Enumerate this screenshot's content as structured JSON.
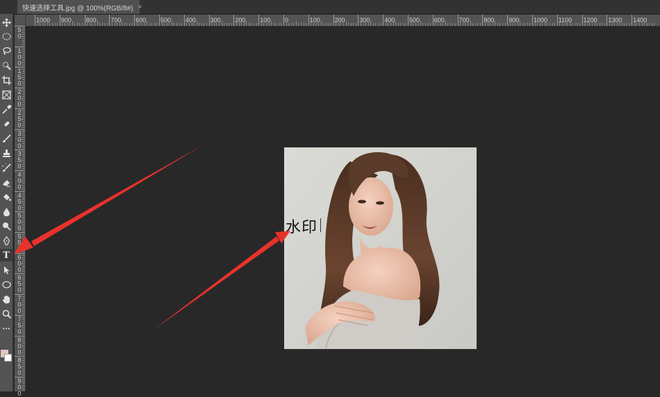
{
  "document_tab": {
    "title": "快速选择工具.jpg @ 100%(RGB/8#)",
    "close_glyph": "×"
  },
  "ruler": {
    "horizontal_labels": [
      "1000",
      "900",
      "800",
      "700",
      "600",
      "500",
      "400",
      "300",
      "200",
      "100",
      "0",
      "100",
      "200",
      "300",
      "400",
      "500",
      "600",
      "700",
      "800",
      "900",
      "1000",
      "1100",
      "1200",
      "1300",
      "1400"
    ],
    "vertical_labels": [
      "5\n0",
      "1\n0\n0",
      "1\n5\n0",
      "2\n0\n0",
      "2\n5\n0",
      "3\n0\n0",
      "3\n5\n0",
      "4\n0\n0",
      "4\n5\n0",
      "5\n0\n0",
      "5\n5\n0",
      "6\n0\n0",
      "6\n5\n0",
      "7\n0\n0",
      "7\n5\n0",
      "8\n0\n0",
      "8\n5\n0",
      "9\n0\n0"
    ]
  },
  "toolbar": {
    "tools": [
      {
        "name": "move-tool",
        "icon": "move-icon"
      },
      {
        "name": "marquee-tool",
        "icon": "ellipse-marquee-icon"
      },
      {
        "name": "lasso-tool",
        "icon": "lasso-icon"
      },
      {
        "name": "quick-selection-tool",
        "icon": "quick-selection-icon"
      },
      {
        "name": "crop-tool",
        "icon": "crop-icon"
      },
      {
        "name": "frame-tool",
        "icon": "frame-icon"
      },
      {
        "name": "eyedropper-tool",
        "icon": "eyedropper-icon"
      },
      {
        "name": "healing-brush-tool",
        "icon": "bandage-icon"
      },
      {
        "name": "brush-tool",
        "icon": "brush-icon"
      },
      {
        "name": "clone-stamp-tool",
        "icon": "stamp-icon"
      },
      {
        "name": "history-brush-tool",
        "icon": "history-brush-icon"
      },
      {
        "name": "eraser-tool",
        "icon": "eraser-icon"
      },
      {
        "name": "paint-bucket-tool",
        "icon": "bucket-icon"
      },
      {
        "name": "blur-tool",
        "icon": "drop-icon"
      },
      {
        "name": "dodge-tool",
        "icon": "dodge-icon"
      },
      {
        "name": "pen-tool",
        "icon": "pen-icon"
      },
      {
        "name": "type-tool",
        "icon": "type-icon",
        "glyph": "T",
        "active": true
      },
      {
        "name": "path-selection-tool",
        "icon": "arrow-icon"
      },
      {
        "name": "ellipse-tool",
        "icon": "ellipse-shape-icon"
      },
      {
        "name": "hand-tool",
        "icon": "hand-icon"
      },
      {
        "name": "zoom-tool",
        "icon": "zoom-icon"
      },
      {
        "name": "more-tools",
        "icon": "ellipsis-icon",
        "glyph": "···"
      }
    ],
    "colors": {
      "foreground": "#e8c6be",
      "background": "#ffffff"
    }
  },
  "canvas": {
    "watermark_text": "水印",
    "annotation_color": "#e8322c"
  }
}
